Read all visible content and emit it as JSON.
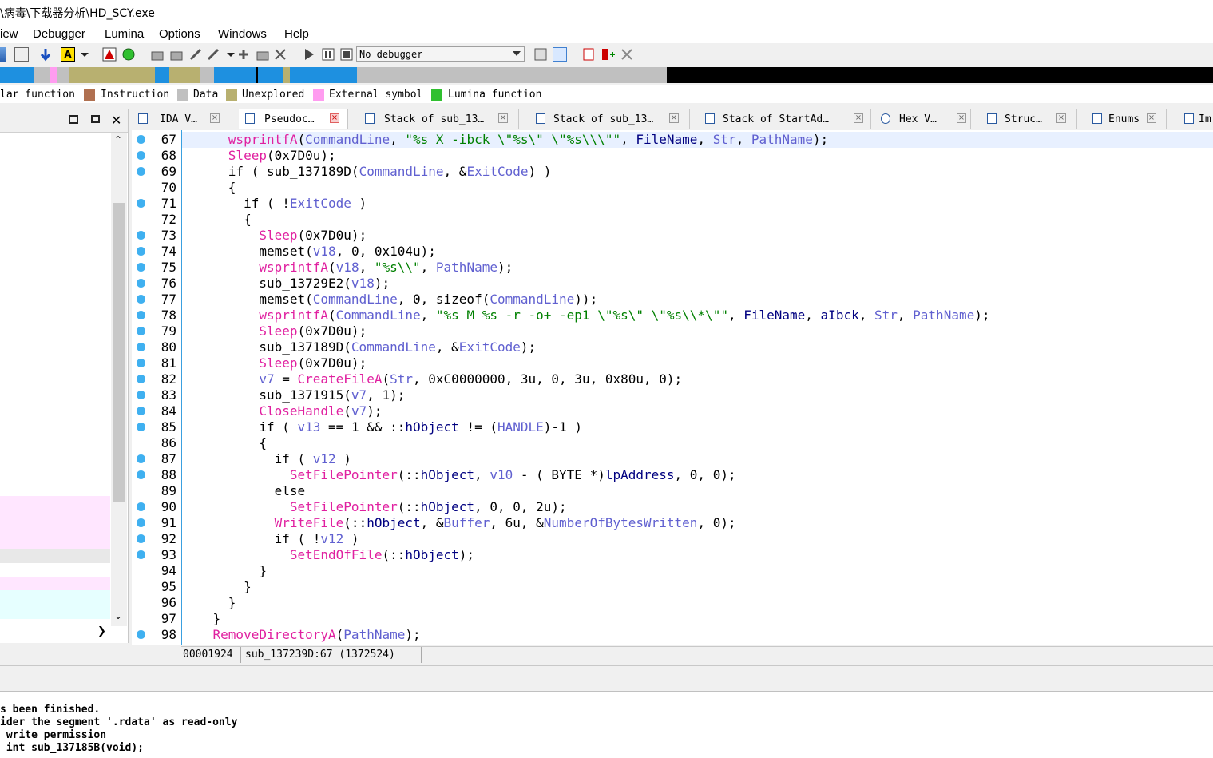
{
  "window": {
    "title": "\\病毒\\下载器分析\\HD_SCY.exe"
  },
  "menu": [
    "iew",
    "Debugger",
    "Lumina",
    "Options",
    "Windows",
    "Help"
  ],
  "toolbar": {
    "debugger_select": "No debugger"
  },
  "legend": [
    {
      "label": "lar function",
      "color": ""
    },
    {
      "label": "Instruction",
      "color": "#b07050"
    },
    {
      "label": "Data",
      "color": "#c0c0c0"
    },
    {
      "label": "Unexplored",
      "color": "#b8b070"
    },
    {
      "label": "External symbol",
      "color": "#ff9cf0"
    },
    {
      "label": "Lumina function",
      "color": "#30c030"
    }
  ],
  "tabs": [
    {
      "label": "IDA V…"
    },
    {
      "label": "Pseudoc…",
      "active": true
    },
    {
      "label": "Stack of sub_13…"
    },
    {
      "label": "Stack of sub_13…"
    },
    {
      "label": "Stack of StartAd…"
    },
    {
      "label": "Hex V…"
    },
    {
      "label": "Struc…"
    },
    {
      "label": "Enums"
    },
    {
      "label": "Im"
    }
  ],
  "code": {
    "lines": [
      {
        "n": "67",
        "dot": true
      },
      {
        "n": "68",
        "dot": true
      },
      {
        "n": "69",
        "dot": true
      },
      {
        "n": "70",
        "dot": false
      },
      {
        "n": "71",
        "dot": true
      },
      {
        "n": "72",
        "dot": false
      },
      {
        "n": "73",
        "dot": true
      },
      {
        "n": "74",
        "dot": true
      },
      {
        "n": "75",
        "dot": true
      },
      {
        "n": "76",
        "dot": true
      },
      {
        "n": "77",
        "dot": true
      },
      {
        "n": "78",
        "dot": true
      },
      {
        "n": "79",
        "dot": true
      },
      {
        "n": "80",
        "dot": true
      },
      {
        "n": "81",
        "dot": true
      },
      {
        "n": "82",
        "dot": true
      },
      {
        "n": "83",
        "dot": true
      },
      {
        "n": "84",
        "dot": true
      },
      {
        "n": "85",
        "dot": true
      },
      {
        "n": "86",
        "dot": false
      },
      {
        "n": "87",
        "dot": true
      },
      {
        "n": "88",
        "dot": true
      },
      {
        "n": "89",
        "dot": false
      },
      {
        "n": "90",
        "dot": true
      },
      {
        "n": "91",
        "dot": true
      },
      {
        "n": "92",
        "dot": true
      },
      {
        "n": "93",
        "dot": true
      },
      {
        "n": "94",
        "dot": false
      },
      {
        "n": "95",
        "dot": false
      },
      {
        "n": "96",
        "dot": false
      },
      {
        "n": "97",
        "dot": false
      },
      {
        "n": "98",
        "dot": true
      }
    ],
    "text": [
      "      wsprintfA(CommandLine, \"%s X -ibck \\\"%s\\\" \\\"%s\\\\\\\"\", FileName, Str, PathName);",
      "      Sleep(0x7D0u);",
      "      if ( sub_137189D(CommandLine, &ExitCode) )",
      "      {",
      "        if ( !ExitCode )",
      "        {",
      "          Sleep(0x7D0u);",
      "          memset(v18, 0, 0x104u);",
      "          wsprintfA(v18, \"%s\\\\\", PathName);",
      "          sub_13729E2(v18);",
      "          memset(CommandLine, 0, sizeof(CommandLine));",
      "          wsprintfA(CommandLine, \"%s M %s -r -o+ -ep1 \\\"%s\\\" \\\"%s\\\\*\\\"\", FileName, aIbck, Str, PathName);",
      "          Sleep(0x7D0u);",
      "          sub_137189D(CommandLine, &ExitCode);",
      "          Sleep(0x7D0u);",
      "          v7 = CreateFileA(Str, 0xC0000000, 3u, 0, 3u, 0x80u, 0);",
      "          sub_1371915(v7, 1);",
      "          CloseHandle(v7);",
      "          if ( v13 == 1 && ::hObject != (HANDLE)-1 )",
      "          {",
      "            if ( v12 )",
      "              SetFilePointer(::hObject, v10 - (_BYTE *)lpAddress, 0, 0);",
      "            else",
      "              SetFilePointer(::hObject, 0, 0, 2u);",
      "            WriteFile(::hObject, &Buffer, 6u, &NumberOfBytesWritten, 0);",
      "            if ( !v12 )",
      "              SetEndOfFile(::hObject);",
      "          }",
      "        }",
      "      }",
      "    }",
      "    RemoveDirectoryA(PathName);"
    ]
  },
  "status": {
    "address": "00001924",
    "location": "sub_137239D:67 (1372524)"
  },
  "output": [
    "s been finished.",
    "ider the segment '.rdata' as read-only",
    " write permission",
    " int sub_137185B(void);"
  ]
}
